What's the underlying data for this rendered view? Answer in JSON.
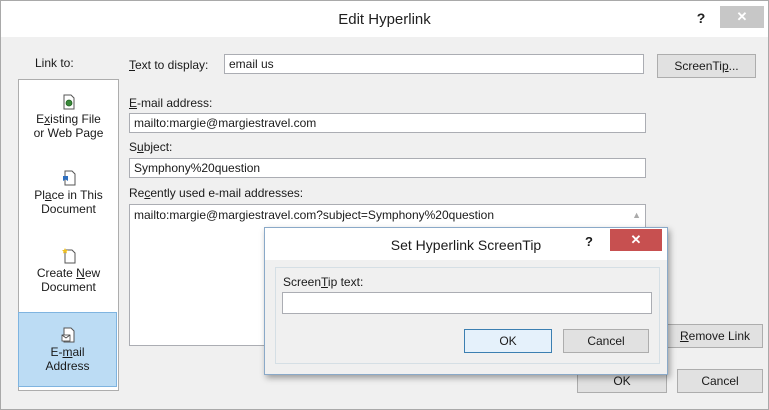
{
  "window": {
    "title": "Edit Hyperlink",
    "help": "?",
    "close": "✕"
  },
  "link_to": {
    "label": "Link to:",
    "items": [
      {
        "pre": "E",
        "ul": "x",
        "post": "isting File",
        "line2": "or Web Page"
      },
      {
        "pre": "Pl",
        "ul": "a",
        "post": "ce in This",
        "line2": "Document"
      },
      {
        "pre": "Create ",
        "ul": "N",
        "post": "ew",
        "line2": "Document"
      },
      {
        "pre": "E-",
        "ul": "m",
        "post": "ail",
        "line2": "Address"
      }
    ]
  },
  "text_to_display": {
    "label_ul": "T",
    "label_rest": "ext to display:",
    "value": "email us"
  },
  "screentip_button": {
    "pre": "ScreenTi",
    "ul": "p",
    "post": "..."
  },
  "email_address": {
    "label_ul": "E",
    "label_rest": "-mail address:",
    "value": "mailto:margie@margiestravel.com"
  },
  "subject": {
    "label_pre": "S",
    "label_ul": "u",
    "label_rest": "bject:",
    "value": "Symphony%20question"
  },
  "recent": {
    "label_pre": "Re",
    "label_ul": "c",
    "label_rest": "ently used e-mail addresses:",
    "items": [
      "mailto:margie@margiestravel.com?subject=Symphony%20question"
    ]
  },
  "remove_link": {
    "ul": "R",
    "rest": "emove Link"
  },
  "ok_label": "OK",
  "cancel_label": "Cancel",
  "screentip_dialog": {
    "title": "Set Hyperlink ScreenTip",
    "help": "?",
    "close": "✕",
    "label_pre": "Screen",
    "label_ul": "T",
    "label_rest": "ip text:",
    "value": "",
    "ok_label": "OK",
    "cancel_label": "Cancel"
  }
}
